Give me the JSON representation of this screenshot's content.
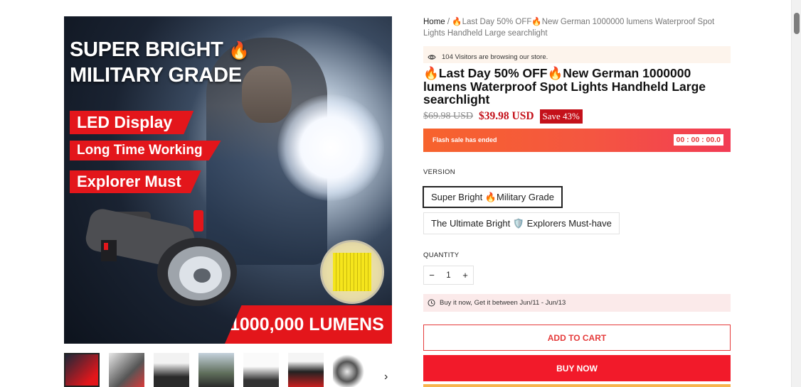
{
  "hero": {
    "title_line1": "SUPER BRIGHT",
    "title_line2": "MILITARY GRADE",
    "tags": [
      "LED Display",
      "Long Time Working",
      "Explorer Must"
    ],
    "lumens": "1000,000 LUMENS"
  },
  "breadcrumb": {
    "home": "Home",
    "separator": "/",
    "current": "🔥Last Day 50% OFF🔥New German 1000000 lumens Waterproof Spot Lights Handheld Large searchlight"
  },
  "visitors": {
    "text": "104 Visitors are browsing our store.",
    "icon": "eye-icon"
  },
  "product": {
    "title": "🔥Last Day 50% OFF🔥New German 1000000 lumens Waterproof Spot Lights Handheld Large searchlight",
    "old_price": "$69.98 USD",
    "sale_price": "$39.98 USD",
    "save_badge": "Save 43%"
  },
  "flash_sale": {
    "text": "Flash sale has ended",
    "timer": "00 : 00 : 00.0"
  },
  "version": {
    "label": "VERSION",
    "options": [
      "Super Bright 🔥Military Grade",
      "The Ultimate Bright 🛡️ Explorers Must-have"
    ],
    "selected": "Super Bright 🔥Military Grade"
  },
  "quantity": {
    "label": "QUANTITY",
    "minus": "−",
    "value": "1",
    "plus": "+"
  },
  "delivery": {
    "text": "Buy it now, Get it between Jun/11 - Jun/13",
    "icon": "clock-icon"
  },
  "buttons": {
    "add_to_cart": "ADD TO CART",
    "buy_now": "BUY NOW"
  },
  "thumbnails": {
    "next": "›",
    "count": 7
  },
  "colors": {
    "accent_red": "#f21a2a",
    "price_red": "#c4111a",
    "flash_orange": "#f7632d"
  }
}
